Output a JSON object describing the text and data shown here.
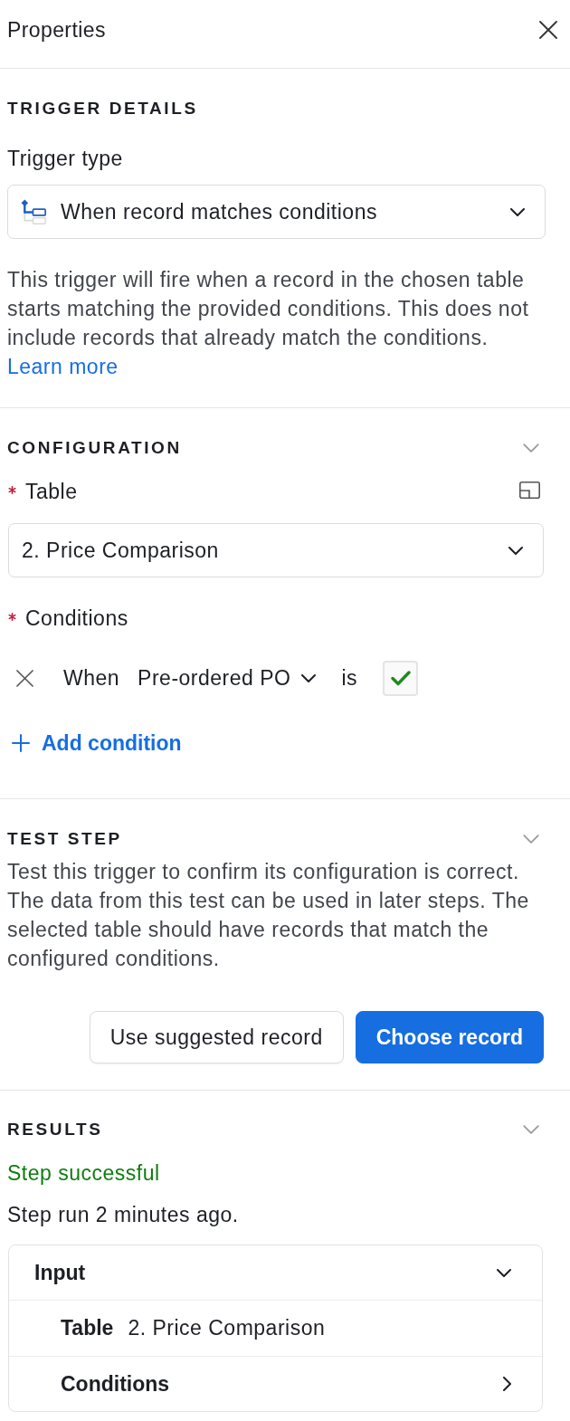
{
  "header": {
    "title": "Properties"
  },
  "trigger_details": {
    "heading": "TRIGGER DETAILS",
    "trigger_type": {
      "label": "Trigger type",
      "value": "When record matches conditions"
    },
    "description": "This trigger will fire when a record in the chosen table starts matching the provided conditions. This does not include records that already match the conditions.",
    "link": "Learn more"
  },
  "configuration": {
    "heading": "CONFIGURATION",
    "expanded": true,
    "table": {
      "label": "Table",
      "required": true,
      "value": "2. Price Comparison"
    },
    "conditions": {
      "label": "Conditions",
      "required": true,
      "items": [
        {
          "prefix": "When",
          "field": "Pre-ordered PO",
          "operator": "is",
          "checked": true
        }
      ],
      "add_label": "Add condition"
    }
  },
  "test_step": {
    "heading": "TEST STEP",
    "expanded": true,
    "description": "Test this trigger to confirm its configuration is correct. The data from this test can be used in later steps. The selected table should have records that match the configured conditions.",
    "buttons": [
      {
        "label": "Use suggested record",
        "kind": "secondary"
      },
      {
        "label": "Choose record",
        "kind": "primary"
      }
    ]
  },
  "results": {
    "heading": "RESULTS",
    "expanded": true,
    "status": "Step successful",
    "run_time": "Step run 2 minutes ago.",
    "input": {
      "title": "Input",
      "expanded": true,
      "rows": [
        {
          "kind": "value",
          "label": "Table",
          "value": "2. Price Comparison"
        },
        {
          "kind": "group",
          "label": "Conditions",
          "expanded": false
        }
      ]
    }
  }
}
